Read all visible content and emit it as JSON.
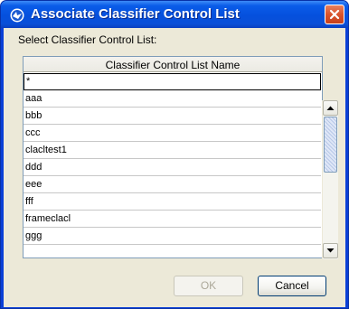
{
  "window": {
    "title": "Associate Classifier Control List"
  },
  "dialog": {
    "prompt": "Select Classifier Control List:"
  },
  "table": {
    "column_header": "Classifier Control List Name",
    "rows": [
      "*",
      "aaa",
      "bbb",
      "ccc",
      "clacltest1",
      "ddd",
      "eee",
      "fff",
      "frameclacl",
      "ggg"
    ]
  },
  "buttons": {
    "ok": "OK",
    "cancel": "Cancel"
  },
  "icons": {
    "title": "dialog-app-icon",
    "close": "close-icon",
    "scroll_up": "arrow-up-icon",
    "scroll_down": "arrow-down-icon"
  },
  "colors": {
    "titlebar": "#0550dd",
    "close_button": "#d9532c",
    "client_bg": "#ece9d8"
  }
}
